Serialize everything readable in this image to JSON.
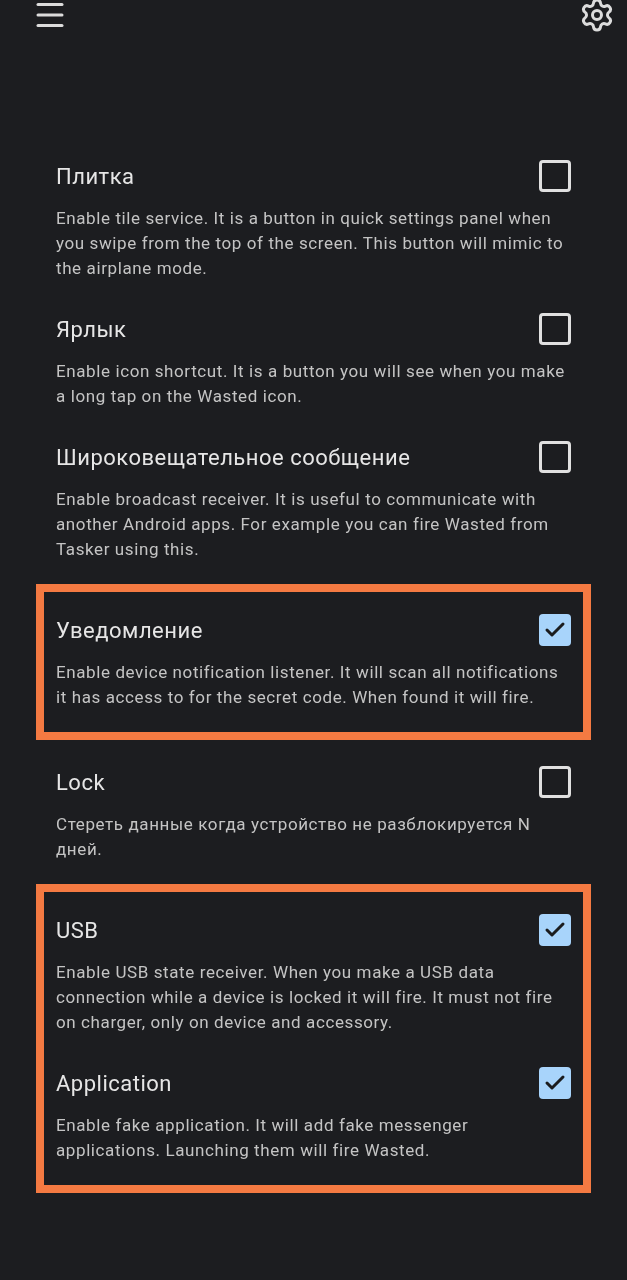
{
  "groups": [
    {
      "highlighted": false,
      "items": [
        {
          "title": "Плитка",
          "checked": false,
          "description": "Enable tile service. It is a button in quick settings panel when you swipe from the top of the screen. This button will mimic to the airplane mode."
        },
        {
          "title": "Ярлык",
          "checked": false,
          "description": "Enable icon shortcut. It is a button you will see when you make a long tap on the Wasted icon."
        },
        {
          "title": "Широковещательное сообщение",
          "checked": false,
          "description": "Enable broadcast receiver. It is useful to communicate with another Android apps. For example you can fire Wasted from Tasker using this."
        }
      ]
    },
    {
      "highlighted": true,
      "items": [
        {
          "title": "Уведомление",
          "checked": true,
          "description": "Enable device notification listener. It will scan all notifications it has access to for the secret code. When found it will fire."
        }
      ]
    },
    {
      "highlighted": false,
      "items": [
        {
          "title": "Lock",
          "checked": false,
          "description": "Стереть данные когда устройство не разблокируется N дней."
        }
      ]
    },
    {
      "highlighted": true,
      "items": [
        {
          "title": "USB",
          "checked": true,
          "description": "Enable USB state receiver. When you make a USB data connection while a device is locked it will fire. It must not fire on charger, only on device and accessory."
        },
        {
          "title": "Application",
          "checked": true,
          "description": "Enable fake application. It will add fake messenger applications. Launching them will fire Wasted."
        }
      ]
    }
  ]
}
